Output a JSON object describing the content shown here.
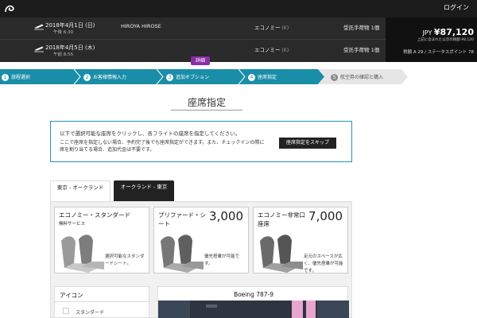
{
  "header": {
    "login_label": "ログイン"
  },
  "itinerary": {
    "passenger": "HIROYA HIROSE",
    "flights": [
      {
        "date": "2018年4月1日 (日)",
        "time": "午後 6:30",
        "class": "エコノミー",
        "class_code": "(K)",
        "baggage": "受託手荷物 1個"
      },
      {
        "date": "2018年4月5日 (木)",
        "time": "午前 8:55",
        "class": "エコノミー",
        "class_code": "(K)",
        "baggage": "受託手荷物 1個"
      }
    ],
    "price_currency": "JPY",
    "price_value": "¥87,120",
    "price_note": "上記に含まれた公示の税額 ¥8,120",
    "status": "税額 A 29 / ステータスポイント 78",
    "details_label": "詳細"
  },
  "steps": [
    {
      "num": "1",
      "label": "旅程選択"
    },
    {
      "num": "2",
      "label": "お客様情報入力"
    },
    {
      "num": "3",
      "label": "追加オプション"
    },
    {
      "num": "4",
      "label": "座席指定"
    },
    {
      "num": "5",
      "label": "航空券の確認と購入"
    }
  ],
  "page_title": "座席指定",
  "info": {
    "line1": "以下で選択可能な座席をクリックし、各フライトの座席を指定してください。",
    "line2": "ここで座席を指定しない場合、予約完了後でも座席指定ができます。また、チェックインの際に席を割り当てる場合、追加代金は不要です。",
    "skip_label": "座席指定をスキップ"
  },
  "tabs": [
    {
      "label": "東京 - オークランド"
    },
    {
      "label": "オークランド - 東京"
    }
  ],
  "cards": [
    {
      "title": "エコノミー・スタンダード",
      "sub": "無料サービス",
      "price": "",
      "desc": "選択可能なスタンダードシート。"
    },
    {
      "title": "プリファード・シート",
      "sub": "",
      "price": "3,000",
      "desc": "優先搭乗が可能です。"
    },
    {
      "title": "エコノミー非常口座席",
      "sub": "",
      "price": "7,000",
      "desc": "足元のスペースが広く、優先搭乗が可能です。"
    }
  ],
  "legend": {
    "title": "アイコン",
    "item": "スタンダード"
  },
  "aircraft": {
    "title": "Boeing 787-9"
  },
  "colors": {
    "progress": "#1a8ea8",
    "accent": "#8b2da6",
    "info_border": "#2a94b8"
  }
}
